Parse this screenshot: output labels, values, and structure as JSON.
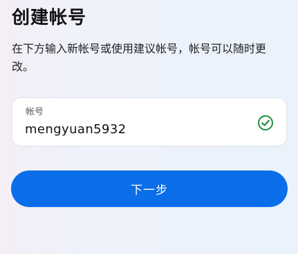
{
  "page": {
    "title": "创建帐号",
    "description": "在下方输入新帐号或使用建议帐号，帐号可以随时更改。"
  },
  "account_field": {
    "label": "帐号",
    "value": "mengyuan5932",
    "status_icon": "check-circle-icon",
    "status_color": "#1e8e3e"
  },
  "next_button": {
    "label": "下一步",
    "color": "#0a6ee8"
  }
}
